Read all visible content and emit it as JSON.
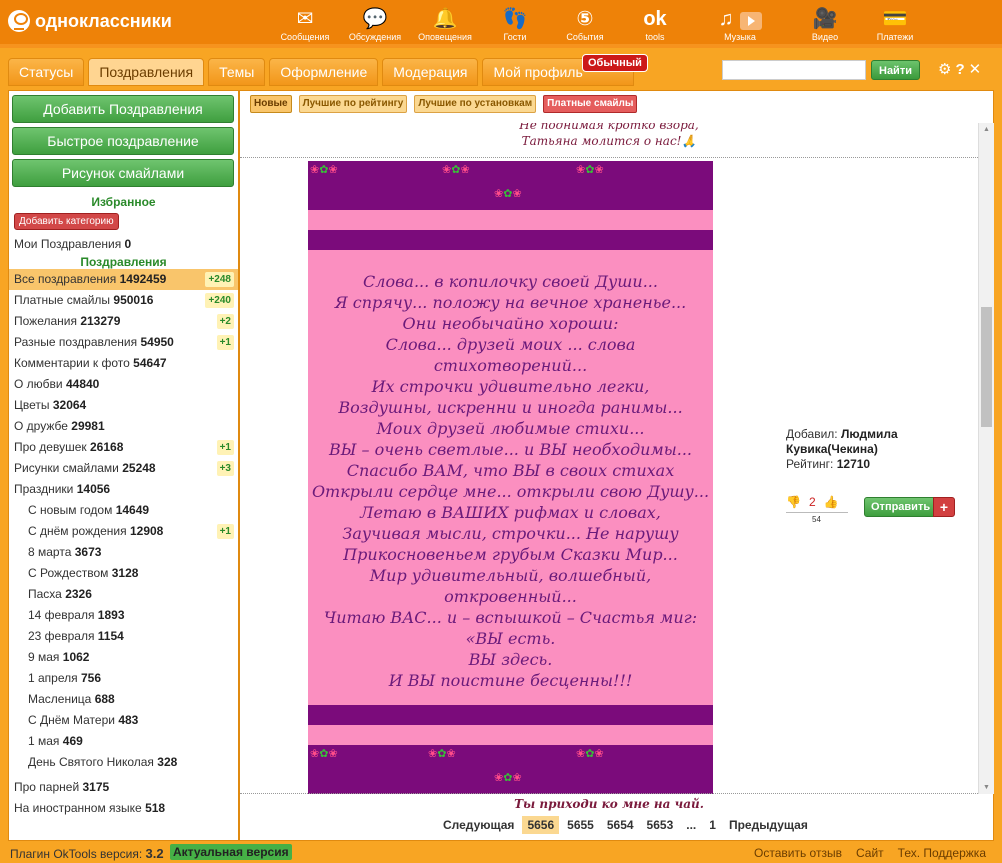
{
  "app": {
    "logo_text": "одноклассники"
  },
  "topnav": [
    {
      "label": "Сообщения",
      "icon": "envelope-icon",
      "glyph": "✉"
    },
    {
      "label": "Обсуждения",
      "icon": "chat-bubbles-icon",
      "glyph": "💬"
    },
    {
      "label": "Оповещения",
      "icon": "bell-icon",
      "glyph": "🔔"
    },
    {
      "label": "Гости",
      "icon": "footprints-icon",
      "glyph": "👣"
    },
    {
      "label": "События",
      "icon": "five-badge-icon",
      "glyph": "⑤"
    },
    {
      "label": "tools",
      "icon": "ok-logo-icon",
      "glyph": "ok"
    },
    {
      "label": "Музыка",
      "icon": "music-note-icon",
      "glyph": "♫"
    },
    {
      "label": "Видео",
      "icon": "camera-icon",
      "glyph": "🎥"
    },
    {
      "label": "Платежи",
      "icon": "wallet-icon",
      "glyph": "💳"
    }
  ],
  "tabs": [
    {
      "label": "Статусы"
    },
    {
      "label": "Поздравления"
    },
    {
      "label": "Темы"
    },
    {
      "label": "Оформление"
    },
    {
      "label": "Модерация"
    },
    {
      "label": "Мой профиль"
    }
  ],
  "badge_plain": "Обычный",
  "search": {
    "placeholder": "",
    "button": "Найти"
  },
  "sidebar": {
    "buttons": [
      "Добавить Поздравления",
      "Быстрое поздравление",
      "Рисунок смайлами"
    ],
    "fav_title": "Избранное",
    "add_category": "Добавить категорию",
    "my_congrats": {
      "label": "Мои Поздравления",
      "count": "0"
    },
    "section_title": "Поздравления",
    "items": [
      {
        "label": "Все поздравления",
        "count": "1492459",
        "plus": "+248",
        "sel": true,
        "sub": false
      },
      {
        "label": "Платные смайлы",
        "count": "950016",
        "plus": "+240",
        "sel": false,
        "sub": false
      },
      {
        "label": "Пожелания",
        "count": "213279",
        "plus": "+2",
        "sel": false,
        "sub": false
      },
      {
        "label": "Разные поздравления",
        "count": "54950",
        "plus": "+1",
        "sel": false,
        "sub": false
      },
      {
        "label": "Комментарии к фото",
        "count": "54647",
        "plus": "",
        "sel": false,
        "sub": false
      },
      {
        "label": "О любви",
        "count": "44840",
        "plus": "",
        "sel": false,
        "sub": false
      },
      {
        "label": "Цветы",
        "count": "32064",
        "plus": "",
        "sel": false,
        "sub": false
      },
      {
        "label": "О дружбе",
        "count": "29981",
        "plus": "",
        "sel": false,
        "sub": false
      },
      {
        "label": "Про девушек",
        "count": "26168",
        "plus": "+1",
        "sel": false,
        "sub": false
      },
      {
        "label": "Рисунки смайлами",
        "count": "25248",
        "plus": "+3",
        "sel": false,
        "sub": false
      },
      {
        "label": "Праздники",
        "count": "14056",
        "plus": "",
        "sel": false,
        "sub": false
      },
      {
        "label": "С новым годом",
        "count": "14649",
        "plus": "",
        "sel": false,
        "sub": true
      },
      {
        "label": "С днём рождения",
        "count": "12908",
        "plus": "+1",
        "sel": false,
        "sub": true
      },
      {
        "label": "8 марта",
        "count": "3673",
        "plus": "",
        "sel": false,
        "sub": true
      },
      {
        "label": "С Рождеством",
        "count": "3128",
        "plus": "",
        "sel": false,
        "sub": true
      },
      {
        "label": "Пасха",
        "count": "2326",
        "plus": "",
        "sel": false,
        "sub": true
      },
      {
        "label": "14 февраля",
        "count": "1893",
        "plus": "",
        "sel": false,
        "sub": true
      },
      {
        "label": "23 февраля",
        "count": "1154",
        "plus": "",
        "sel": false,
        "sub": true
      },
      {
        "label": "9 мая",
        "count": "1062",
        "plus": "",
        "sel": false,
        "sub": true
      },
      {
        "label": "1 апреля",
        "count": "756",
        "plus": "",
        "sel": false,
        "sub": true
      },
      {
        "label": "Масленица",
        "count": "688",
        "plus": "",
        "sel": false,
        "sub": true
      },
      {
        "label": "С Днём Матери",
        "count": "483",
        "plus": "",
        "sel": false,
        "sub": true
      },
      {
        "label": "1 мая",
        "count": "469",
        "plus": "",
        "sel": false,
        "sub": true
      },
      {
        "label": "День Святого Николая",
        "count": "328",
        "plus": "",
        "sel": false,
        "sub": true
      },
      {
        "label": "Про парней",
        "count": "3175",
        "plus": "",
        "sel": false,
        "sub": false
      },
      {
        "label": "На иностранном языке",
        "count": "518",
        "plus": "",
        "sel": false,
        "sub": false
      }
    ]
  },
  "filters": [
    "Новые",
    "Лучшие по рейтингу",
    "Лучшие по установкам",
    "Платные смайлы"
  ],
  "top_poem": [
    "Не поднимая кротко взора,",
    "Татьяна молится о нас!🙏"
  ],
  "poem": [
    "Слова... в копилочку своей Души...",
    "Я спрячу... положу на вечное храненье...",
    "Они необычайно хороши:",
    "Слова... друзей моих ... слова стихотворений...",
    "Их строчки удивительно легки,",
    "Воздушны, искренни и иногда ранимы...",
    "Моих друзей любимые стихи...",
    "ВЫ – очень светлые... и ВЫ необходимы...",
    "Спасибо ВАМ, что ВЫ в своих стихах",
    "Открыли сердце мне... открыли свою Душу...",
    "Летаю в ВАШИХ рифмах и словах,",
    "Заучивая мысли, строчки... Не нарушу",
    "Прикосновеньем грубым Сказки Мир...",
    "Мир удивительный, волшебный,",
    "откровенный...",
    "Читаю ВАС... и – вспышкой – Счастья миг:",
    "«ВЫ есть.",
    "ВЫ здесь.",
    "И ВЫ поистине бесценны!!!"
  ],
  "meta": {
    "added_by_label": "Добавил:",
    "author": "Людмила Кувика(Чекина)",
    "rating_label": "Рейтинг:",
    "rating": "12710",
    "votes": "2",
    "votes_total": "54",
    "send": "Отправить",
    "plus": "+"
  },
  "bottom_poem": "Ты приходи ко мне на чай.",
  "pager": {
    "next": "Следующая",
    "pages": [
      "5656",
      "5655",
      "5654",
      "5653",
      "...",
      "1"
    ],
    "current": "5656",
    "prev": "Предыдущая"
  },
  "footer": {
    "version_label": "Плагин OkTools версия:",
    "version": "3.2",
    "actual": "Актуальная версия",
    "links": [
      "Оставить отзыв",
      "Сайт",
      "Тех. Поддержка"
    ]
  },
  "colors": {
    "brand": "#ee8208",
    "card_pink": "#fb8fc0",
    "card_purple": "#7b0b7b",
    "accent_green": "#46b046"
  }
}
